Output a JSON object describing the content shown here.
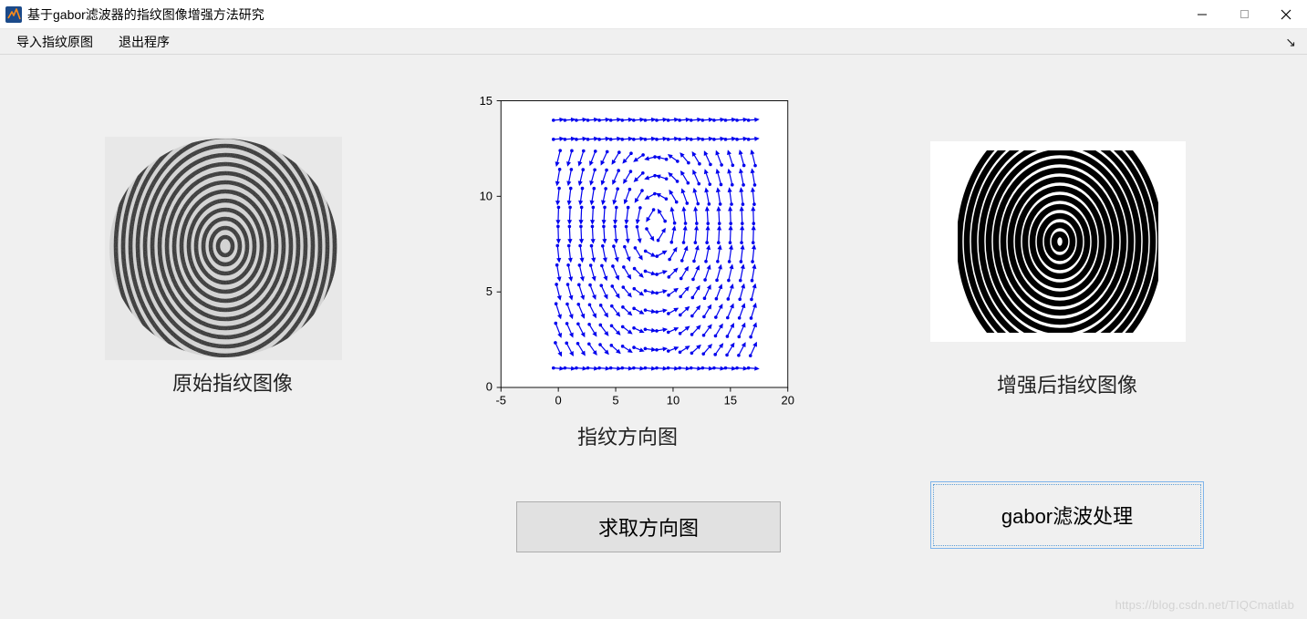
{
  "window": {
    "title": "基于gabor滤波器的指纹图像增强方法研究"
  },
  "menu": {
    "import": "导入指纹原图",
    "exit": "退出程序"
  },
  "panels": {
    "raw_caption": "原始指纹图像",
    "enhanced_caption": "增强后指纹图像",
    "orientation_caption": "指纹方向图"
  },
  "buttons": {
    "compute_orientation": "求取方向图",
    "gabor_filter": "gabor滤波处理"
  },
  "chart_data": {
    "type": "quiver",
    "title": "指纹方向图",
    "xlabel": "",
    "ylabel": "",
    "xlim": [
      -5,
      20
    ],
    "ylim": [
      0,
      15
    ],
    "xticks": [
      -5,
      0,
      5,
      10,
      15,
      20
    ],
    "yticks": [
      0,
      5,
      10,
      15
    ],
    "grid": false,
    "description": "blue orientation-field arrows on a ~17×14 grid inside a box, forming a whorl/loop fingerprint flow pattern"
  },
  "xticks": {
    "t0": "-5",
    "t1": "0",
    "t2": "5",
    "t3": "10",
    "t4": "15",
    "t5": "20"
  },
  "yticks": {
    "t0": "0",
    "t1": "5",
    "t2": "10",
    "t3": "15"
  },
  "watermark": "https://blog.csdn.net/TIQCmatlab"
}
